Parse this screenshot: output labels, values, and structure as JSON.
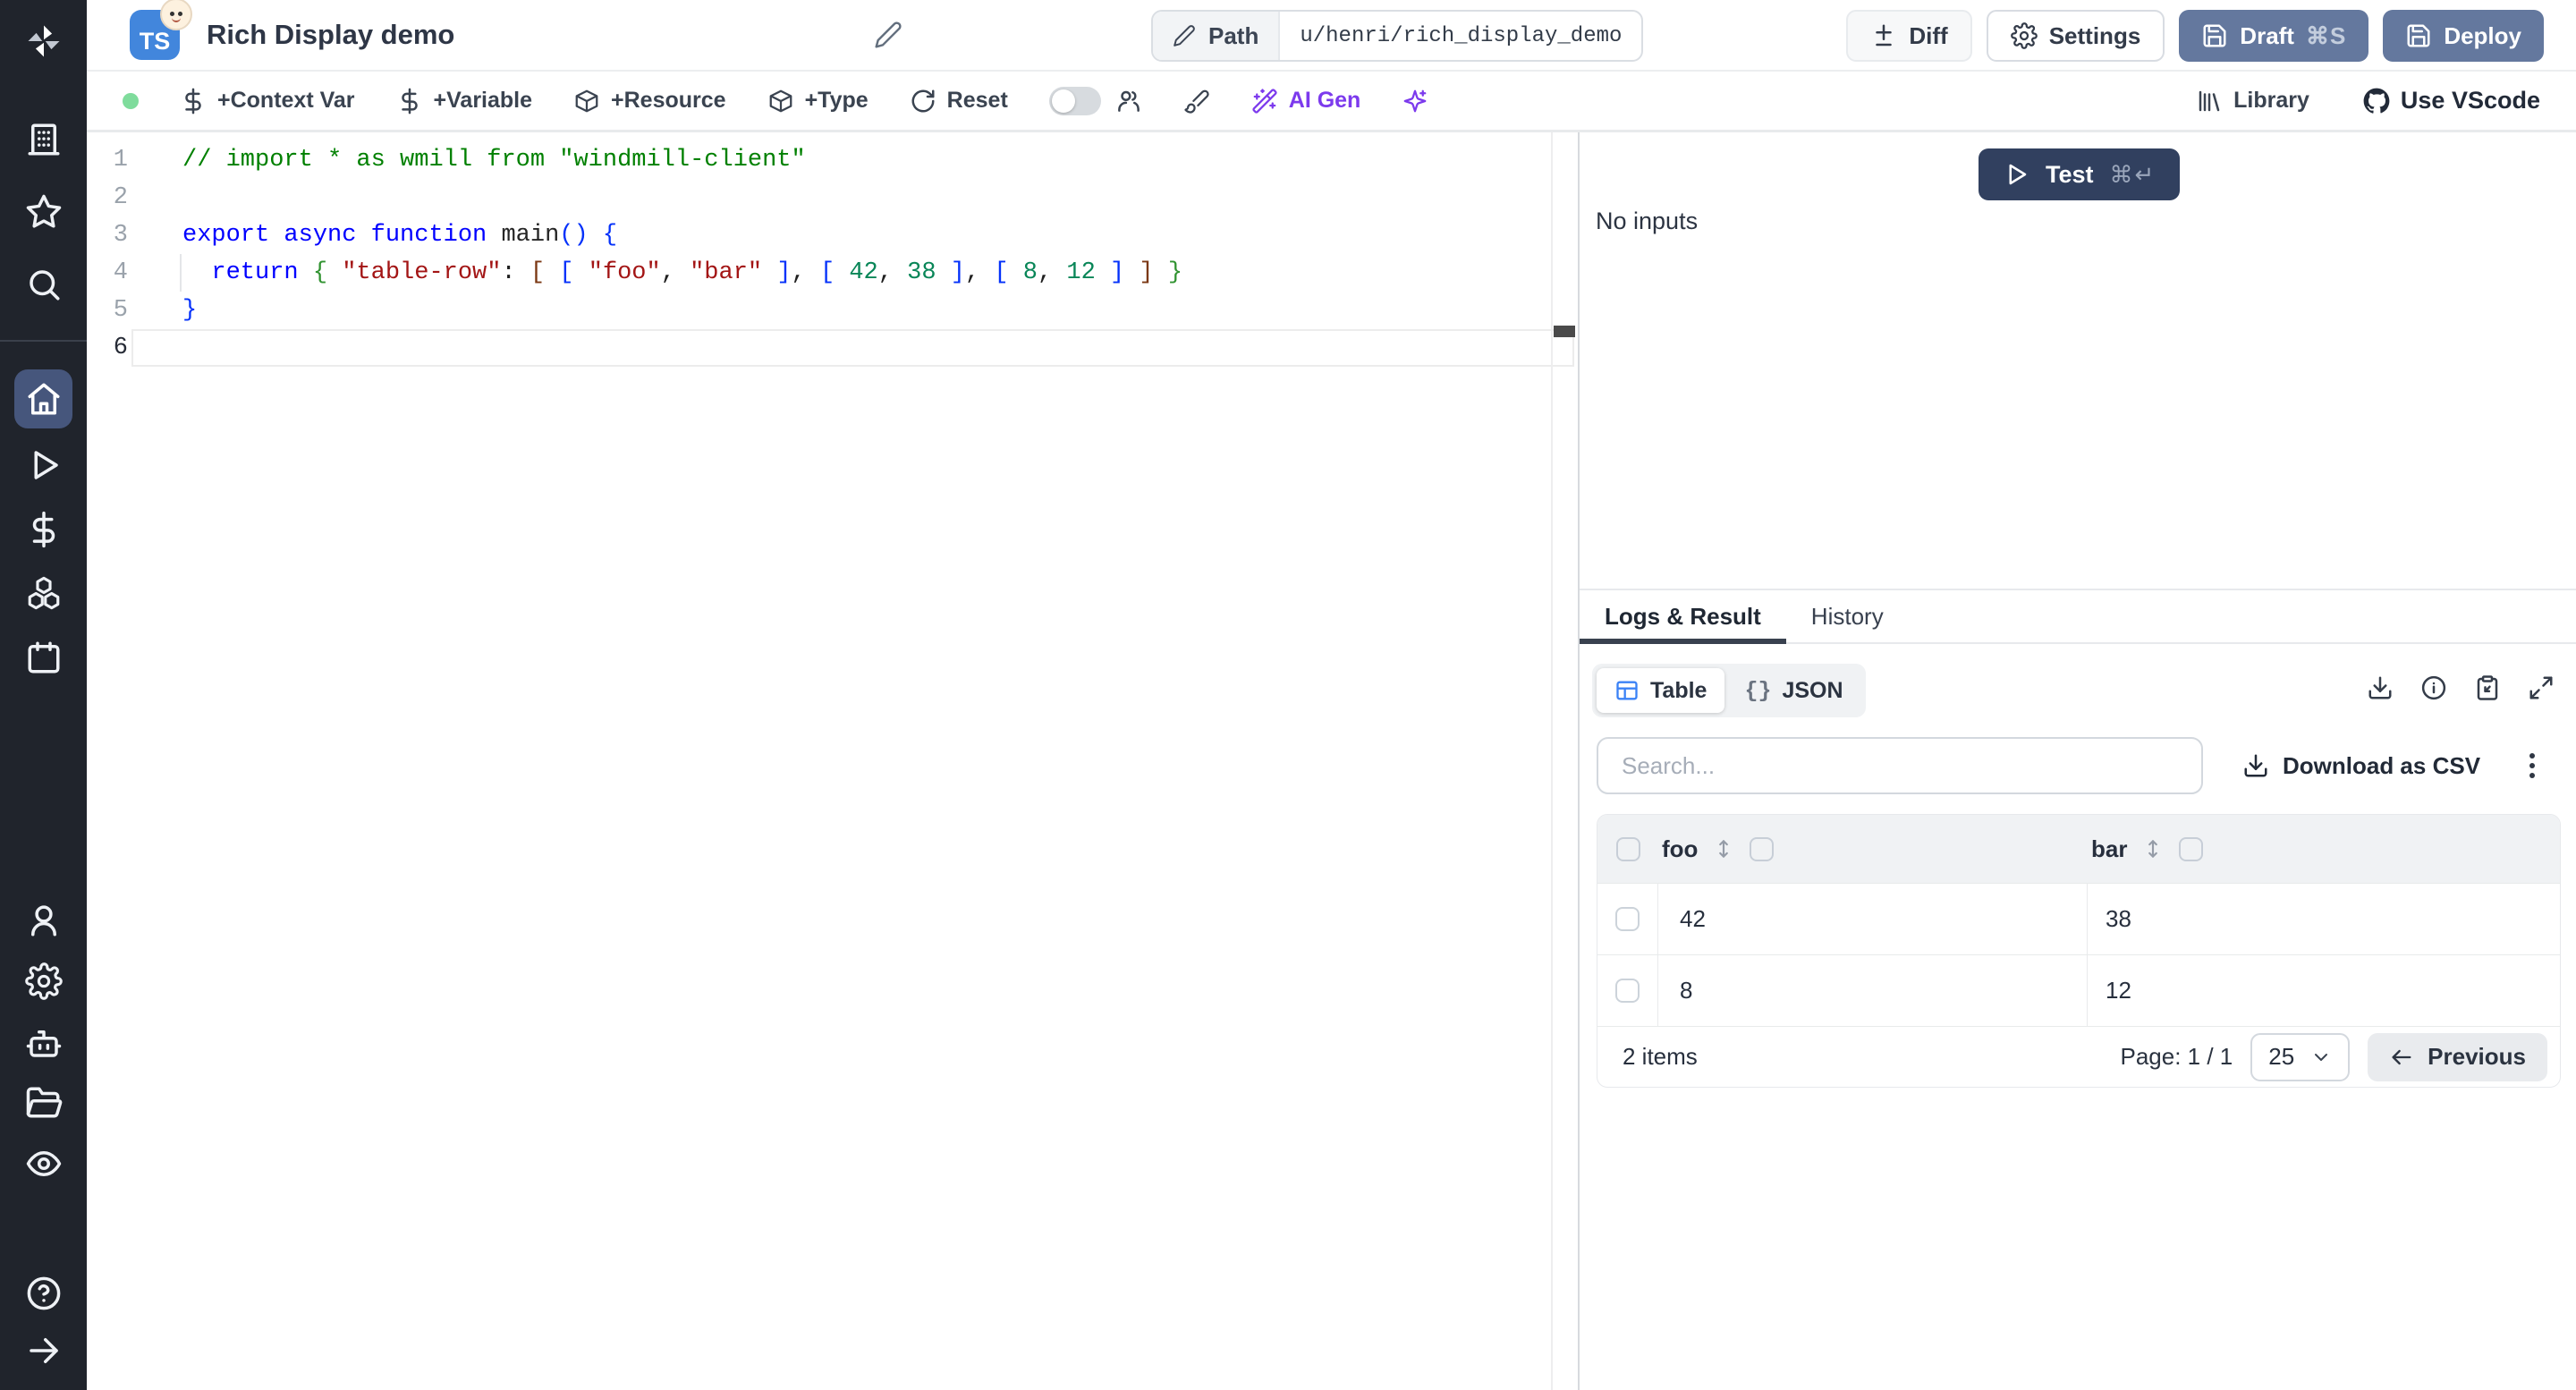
{
  "header": {
    "badge": "TS",
    "title": "Rich Display demo",
    "path_label": "Path",
    "path_value": "u/henri/rich_display_demo",
    "diff_label": "Diff",
    "settings_label": "Settings",
    "draft_label": "Draft",
    "draft_shortcut": "⌘S",
    "deploy_label": "Deploy"
  },
  "toolbar": {
    "context_var": "+Context Var",
    "variable": "+Variable",
    "resource": "+Resource",
    "type": "+Type",
    "reset": "Reset",
    "ai_gen": "AI Gen",
    "library": "Library",
    "use_vscode": "Use VScode"
  },
  "editor": {
    "token_colors": {
      "comment": "#008000",
      "keyword": "#0000ff",
      "string": "#a31515",
      "number": "#098658",
      "bracket1": "#0431fa",
      "bracket2": "#319331",
      "bracket3": "#7b3814",
      "function": "#262626",
      "plain": "#1f1f1f"
    },
    "lines": [
      {
        "number": "1",
        "tokens": [
          {
            "text": "// import * as wmill from \"windmill-client\"",
            "color": "comment"
          }
        ]
      },
      {
        "number": "2",
        "tokens": []
      },
      {
        "number": "3",
        "tokens": [
          {
            "text": "export async function ",
            "color": "keyword"
          },
          {
            "text": "main",
            "color": "function"
          },
          {
            "text": "() {",
            "color": "bracket1"
          }
        ]
      },
      {
        "number": "4",
        "tokens": [
          {
            "text": "  ",
            "color": "plain"
          },
          {
            "text": "return",
            "color": "keyword"
          },
          {
            "text": " ",
            "color": "plain"
          },
          {
            "text": "{",
            "color": "bracket2"
          },
          {
            "text": " ",
            "color": "plain"
          },
          {
            "text": "\"table-row\"",
            "color": "string"
          },
          {
            "text": ": ",
            "color": "plain"
          },
          {
            "text": "[",
            "color": "bracket3"
          },
          {
            "text": " ",
            "color": "plain"
          },
          {
            "text": "[",
            "color": "bracket1"
          },
          {
            "text": " ",
            "color": "plain"
          },
          {
            "text": "\"foo\"",
            "color": "string"
          },
          {
            "text": ", ",
            "color": "plain"
          },
          {
            "text": "\"bar\"",
            "color": "string"
          },
          {
            "text": " ",
            "color": "plain"
          },
          {
            "text": "]",
            "color": "bracket1"
          },
          {
            "text": ", ",
            "color": "plain"
          },
          {
            "text": "[",
            "color": "bracket1"
          },
          {
            "text": " ",
            "color": "plain"
          },
          {
            "text": "42",
            "color": "number"
          },
          {
            "text": ", ",
            "color": "plain"
          },
          {
            "text": "38",
            "color": "number"
          },
          {
            "text": " ",
            "color": "plain"
          },
          {
            "text": "]",
            "color": "bracket1"
          },
          {
            "text": ", ",
            "color": "plain"
          },
          {
            "text": "[",
            "color": "bracket1"
          },
          {
            "text": " ",
            "color": "plain"
          },
          {
            "text": "8",
            "color": "number"
          },
          {
            "text": ", ",
            "color": "plain"
          },
          {
            "text": "12",
            "color": "number"
          },
          {
            "text": " ",
            "color": "plain"
          },
          {
            "text": "]",
            "color": "bracket1"
          },
          {
            "text": " ",
            "color": "plain"
          },
          {
            "text": "]",
            "color": "bracket3"
          },
          {
            "text": " ",
            "color": "plain"
          },
          {
            "text": "}",
            "color": "bracket2"
          }
        ]
      },
      {
        "number": "5",
        "tokens": [
          {
            "text": "}",
            "color": "bracket1"
          }
        ]
      },
      {
        "number": "6",
        "tokens": [],
        "current": true
      }
    ]
  },
  "run_panel": {
    "test_label": "Test",
    "test_shortcut": "⌘↵",
    "no_inputs": "No inputs"
  },
  "result_panel": {
    "tabs": [
      {
        "label": "Logs & Result",
        "active": true
      },
      {
        "label": "History",
        "active": false
      }
    ],
    "view_table_label": "Table",
    "view_json_label": "JSON",
    "braces_glyph": "{}",
    "search_placeholder": "Search...",
    "download_csv_label": "Download as CSV",
    "items_count": "2 items",
    "page_label": "Page: 1 / 1",
    "page_size": "25",
    "previous_label": "Previous"
  },
  "result_table": {
    "columns": [
      {
        "label": "foo"
      },
      {
        "label": "bar"
      }
    ],
    "rows": [
      [
        "42",
        "38"
      ],
      [
        "8",
        "12"
      ]
    ]
  },
  "colors": {
    "sidebar_bg": "#20242c",
    "sidebar_active": "#46567c",
    "primary_slate": "#64789e",
    "test_button_navy": "#31405f",
    "ai_purple": "#7c3aed",
    "status_green": "#7fdc9c",
    "ts_badge_blue": "#4286dc",
    "table_icon_blue": "#3b82f6"
  }
}
